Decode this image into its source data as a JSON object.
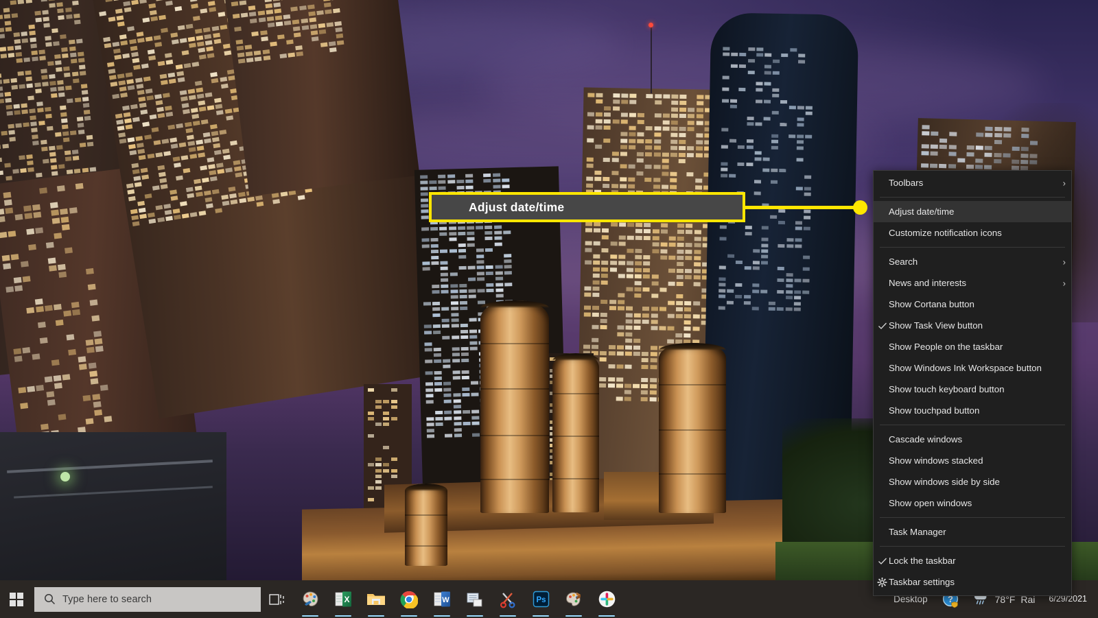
{
  "callout": {
    "label": "Adjust date/time",
    "border_color": "#ffe600",
    "fill_color": "#474747"
  },
  "context_menu": {
    "name": "taskbar-context-menu",
    "background": "#1f1f1f",
    "highlight_color": "#333333",
    "groups": [
      {
        "items": [
          {
            "label": "Toolbars",
            "submenu": true,
            "checked": false,
            "icon": "",
            "highlight": false
          }
        ]
      },
      {
        "items": [
          {
            "label": "Adjust date/time",
            "submenu": false,
            "checked": false,
            "icon": "",
            "highlight": true
          },
          {
            "label": "Customize notification icons",
            "submenu": false,
            "checked": false,
            "icon": "",
            "highlight": false
          }
        ]
      },
      {
        "items": [
          {
            "label": "Search",
            "submenu": true,
            "checked": false,
            "icon": "",
            "highlight": false
          },
          {
            "label": "News and interests",
            "submenu": true,
            "checked": false,
            "icon": "",
            "highlight": false
          },
          {
            "label": "Show Cortana button",
            "submenu": false,
            "checked": false,
            "icon": "",
            "highlight": false
          },
          {
            "label": "Show Task View button",
            "submenu": false,
            "checked": true,
            "icon": "",
            "highlight": false
          },
          {
            "label": "Show People on the taskbar",
            "submenu": false,
            "checked": false,
            "icon": "",
            "highlight": false
          },
          {
            "label": "Show Windows Ink Workspace button",
            "submenu": false,
            "checked": false,
            "icon": "",
            "highlight": false
          },
          {
            "label": "Show touch keyboard button",
            "submenu": false,
            "checked": false,
            "icon": "",
            "highlight": false
          },
          {
            "label": "Show touchpad button",
            "submenu": false,
            "checked": false,
            "icon": "",
            "highlight": false
          }
        ]
      },
      {
        "items": [
          {
            "label": "Cascade windows",
            "submenu": false,
            "checked": false,
            "icon": "",
            "highlight": false
          },
          {
            "label": "Show windows stacked",
            "submenu": false,
            "checked": false,
            "icon": "",
            "highlight": false
          },
          {
            "label": "Show windows side by side",
            "submenu": false,
            "checked": false,
            "icon": "",
            "highlight": false
          },
          {
            "label": "Show open windows",
            "submenu": false,
            "checked": false,
            "icon": "",
            "highlight": false
          }
        ]
      },
      {
        "items": [
          {
            "label": "Task Manager",
            "submenu": false,
            "checked": false,
            "icon": "",
            "highlight": false
          }
        ]
      },
      {
        "items": [
          {
            "label": "Lock the taskbar",
            "submenu": false,
            "checked": true,
            "icon": "",
            "highlight": false
          },
          {
            "label": "Taskbar settings",
            "submenu": false,
            "checked": false,
            "icon": "gear-icon",
            "highlight": false
          }
        ]
      }
    ]
  },
  "taskbar": {
    "background": "#2b2724",
    "start_button": "start-button",
    "search": {
      "placeholder": "Type here to search",
      "icon": "search-icon",
      "background": "#c8c6c4"
    },
    "pinned_apps": [
      {
        "name": "task-view-button",
        "label": "Task View"
      },
      {
        "name": "paint-app",
        "label": "Paint"
      },
      {
        "name": "excel-app",
        "label": "Excel"
      },
      {
        "name": "file-explorer-app",
        "label": "File Explorer"
      },
      {
        "name": "chrome-app",
        "label": "Google Chrome"
      },
      {
        "name": "word-app",
        "label": "Word"
      },
      {
        "name": "sticky-notes-app",
        "label": "Sticky Notes"
      },
      {
        "name": "snipping-tool-app",
        "label": "Snipping Tool"
      },
      {
        "name": "photoshop-app",
        "label": "Photoshop"
      },
      {
        "name": "paint3d-app",
        "label": "Paint 3D"
      },
      {
        "name": "slack-app",
        "label": "Slack"
      }
    ],
    "tray": {
      "desktop_label": "Desktop",
      "overflow_chevron": "»",
      "help_icon": "help-shield-icon",
      "weather": {
        "icon": "rain-cloud-icon",
        "temperature": "78°F",
        "condition": "Rai"
      },
      "clock": {
        "time": "",
        "date": "6/29/2021"
      }
    }
  },
  "wallpaper": {
    "name": "houston-night-cityscape",
    "sky_color": "#4a3a6e",
    "accent_color": "#c99153"
  }
}
